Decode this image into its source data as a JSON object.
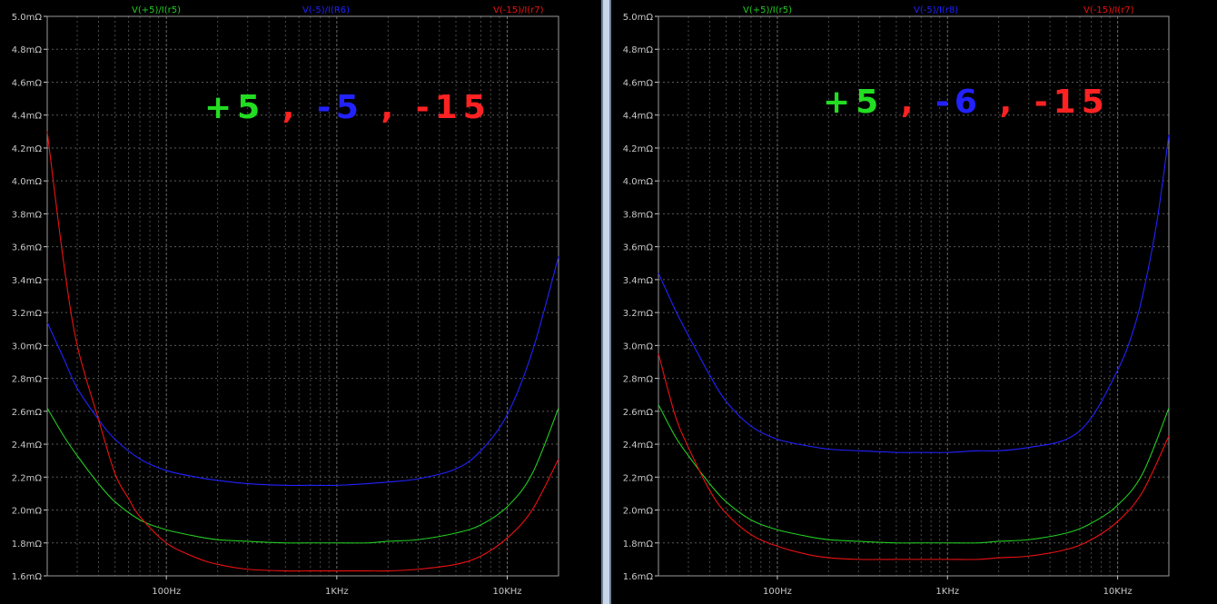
{
  "panes": [
    {
      "trace_labels": [
        "V(+5)/I(r5)",
        "V(-5)/I(R6)",
        "V(-15)/I(r7)"
      ],
      "annotation": [
        {
          "text": "+5",
          "color": "#22dd22"
        },
        {
          "text": ",",
          "color": "#ff2222"
        },
        {
          "text": "-5",
          "color": "#2222ff"
        },
        {
          "text": ",",
          "color": "#ff2222"
        },
        {
          "text": "-15",
          "color": "#ff2222"
        }
      ]
    },
    {
      "trace_labels": [
        "V(+5)/I(r5)",
        "V(-5)/I(r8)",
        "V(-15)/I(r7)"
      ],
      "annotation": [
        {
          "text": "+5",
          "color": "#22dd22"
        },
        {
          "text": ",",
          "color": "#ff2222"
        },
        {
          "text": "-6",
          "color": "#2222ff"
        },
        {
          "text": ",",
          "color": "#ff2222"
        },
        {
          "text": "-15",
          "color": "#ff2222"
        }
      ]
    }
  ],
  "chart_data": [
    {
      "type": "line",
      "x_scale": "log",
      "xlim": [
        20,
        20000
      ],
      "ylim": [
        1.6,
        5.0
      ],
      "x_tick_labels": [
        {
          "v": 100,
          "t": "100Hz"
        },
        {
          "v": 1000,
          "t": "1KHz"
        },
        {
          "v": 10000,
          "t": "10KHz"
        }
      ],
      "y_tick_labels": [
        "1.6mΩ",
        "1.8mΩ",
        "2.0mΩ",
        "2.2mΩ",
        "2.4mΩ",
        "2.6mΩ",
        "2.8mΩ",
        "3.0mΩ",
        "3.2mΩ",
        "3.4mΩ",
        "3.6mΩ",
        "3.8mΩ",
        "4.0mΩ",
        "4.2mΩ",
        "4.4mΩ",
        "4.6mΩ",
        "4.8mΩ",
        "5.0mΩ"
      ],
      "grid": true,
      "series": [
        {
          "name": "V(+5)/I(r5)",
          "color": "#22cc22",
          "x": [
            20,
            25,
            30,
            40,
            50,
            70,
            100,
            150,
            200,
            300,
            500,
            700,
            1000,
            1500,
            2000,
            3000,
            5000,
            7000,
            10000,
            14000,
            20000
          ],
          "y": [
            2.62,
            2.45,
            2.33,
            2.16,
            2.05,
            1.94,
            1.88,
            1.84,
            1.82,
            1.81,
            1.8,
            1.8,
            1.8,
            1.8,
            1.81,
            1.82,
            1.86,
            1.91,
            2.02,
            2.22,
            2.62
          ]
        },
        {
          "name": "V(-5)/I(R6)",
          "color": "#2222ff",
          "x": [
            20,
            25,
            30,
            40,
            50,
            70,
            100,
            150,
            200,
            300,
            500,
            700,
            1000,
            1500,
            2000,
            3000,
            5000,
            7000,
            10000,
            14000,
            20000
          ],
          "y": [
            3.14,
            2.92,
            2.74,
            2.55,
            2.43,
            2.31,
            2.24,
            2.2,
            2.18,
            2.16,
            2.15,
            2.15,
            2.15,
            2.16,
            2.17,
            2.19,
            2.25,
            2.36,
            2.58,
            2.96,
            3.54
          ]
        },
        {
          "name": "V(-15)/I(r7)",
          "color": "#ee1111",
          "x": [
            20,
            25,
            30,
            40,
            50,
            60,
            70,
            100,
            150,
            200,
            300,
            500,
            700,
            1000,
            1500,
            2000,
            3000,
            5000,
            7000,
            10000,
            14000,
            20000
          ],
          "y": [
            4.3,
            3.5,
            3.0,
            2.55,
            2.22,
            2.07,
            1.96,
            1.8,
            1.71,
            1.67,
            1.64,
            1.63,
            1.63,
            1.63,
            1.63,
            1.63,
            1.64,
            1.67,
            1.72,
            1.83,
            2.0,
            2.31
          ]
        }
      ]
    },
    {
      "type": "line",
      "x_scale": "log",
      "xlim": [
        20,
        20000
      ],
      "ylim": [
        1.6,
        5.0
      ],
      "x_tick_labels": [
        {
          "v": 100,
          "t": "100Hz"
        },
        {
          "v": 1000,
          "t": "1KHz"
        },
        {
          "v": 10000,
          "t": "10KHz"
        }
      ],
      "y_tick_labels": [
        "1.6mΩ",
        "1.8mΩ",
        "2.0mΩ",
        "2.2mΩ",
        "2.4mΩ",
        "2.6mΩ",
        "2.8mΩ",
        "3.0mΩ",
        "3.2mΩ",
        "3.4mΩ",
        "3.6mΩ",
        "3.8mΩ",
        "4.0mΩ",
        "4.2mΩ",
        "4.4mΩ",
        "4.6mΩ",
        "4.8mΩ",
        "5.0mΩ"
      ],
      "grid": true,
      "series": [
        {
          "name": "V(+5)/I(r5)",
          "color": "#22cc22",
          "x": [
            20,
            25,
            30,
            40,
            50,
            70,
            100,
            150,
            200,
            300,
            500,
            700,
            1000,
            1500,
            2000,
            3000,
            5000,
            7000,
            10000,
            14000,
            20000
          ],
          "y": [
            2.64,
            2.45,
            2.33,
            2.16,
            2.05,
            1.94,
            1.88,
            1.84,
            1.82,
            1.81,
            1.8,
            1.8,
            1.8,
            1.8,
            1.81,
            1.82,
            1.86,
            1.92,
            2.03,
            2.22,
            2.62
          ]
        },
        {
          "name": "V(-5)/I(r8)",
          "color": "#2222ff",
          "x": [
            20,
            25,
            30,
            40,
            50,
            70,
            100,
            150,
            200,
            300,
            500,
            700,
            1000,
            1500,
            2000,
            3000,
            5000,
            7000,
            10000,
            12000,
            14000,
            17000,
            20000
          ],
          "y": [
            3.44,
            3.22,
            3.06,
            2.82,
            2.66,
            2.51,
            2.43,
            2.39,
            2.37,
            2.36,
            2.35,
            2.35,
            2.35,
            2.36,
            2.36,
            2.38,
            2.43,
            2.56,
            2.85,
            3.05,
            3.3,
            3.75,
            4.28
          ]
        },
        {
          "name": "V(-15)/I(r7)",
          "color": "#ee1111",
          "x": [
            20,
            25,
            30,
            40,
            50,
            70,
            100,
            150,
            200,
            300,
            500,
            700,
            1000,
            1500,
            2000,
            3000,
            5000,
            7000,
            10000,
            14000,
            20000
          ],
          "y": [
            2.95,
            2.58,
            2.38,
            2.12,
            1.98,
            1.85,
            1.78,
            1.73,
            1.71,
            1.7,
            1.7,
            1.7,
            1.7,
            1.7,
            1.71,
            1.72,
            1.76,
            1.82,
            1.93,
            2.11,
            2.45
          ]
        }
      ]
    }
  ]
}
